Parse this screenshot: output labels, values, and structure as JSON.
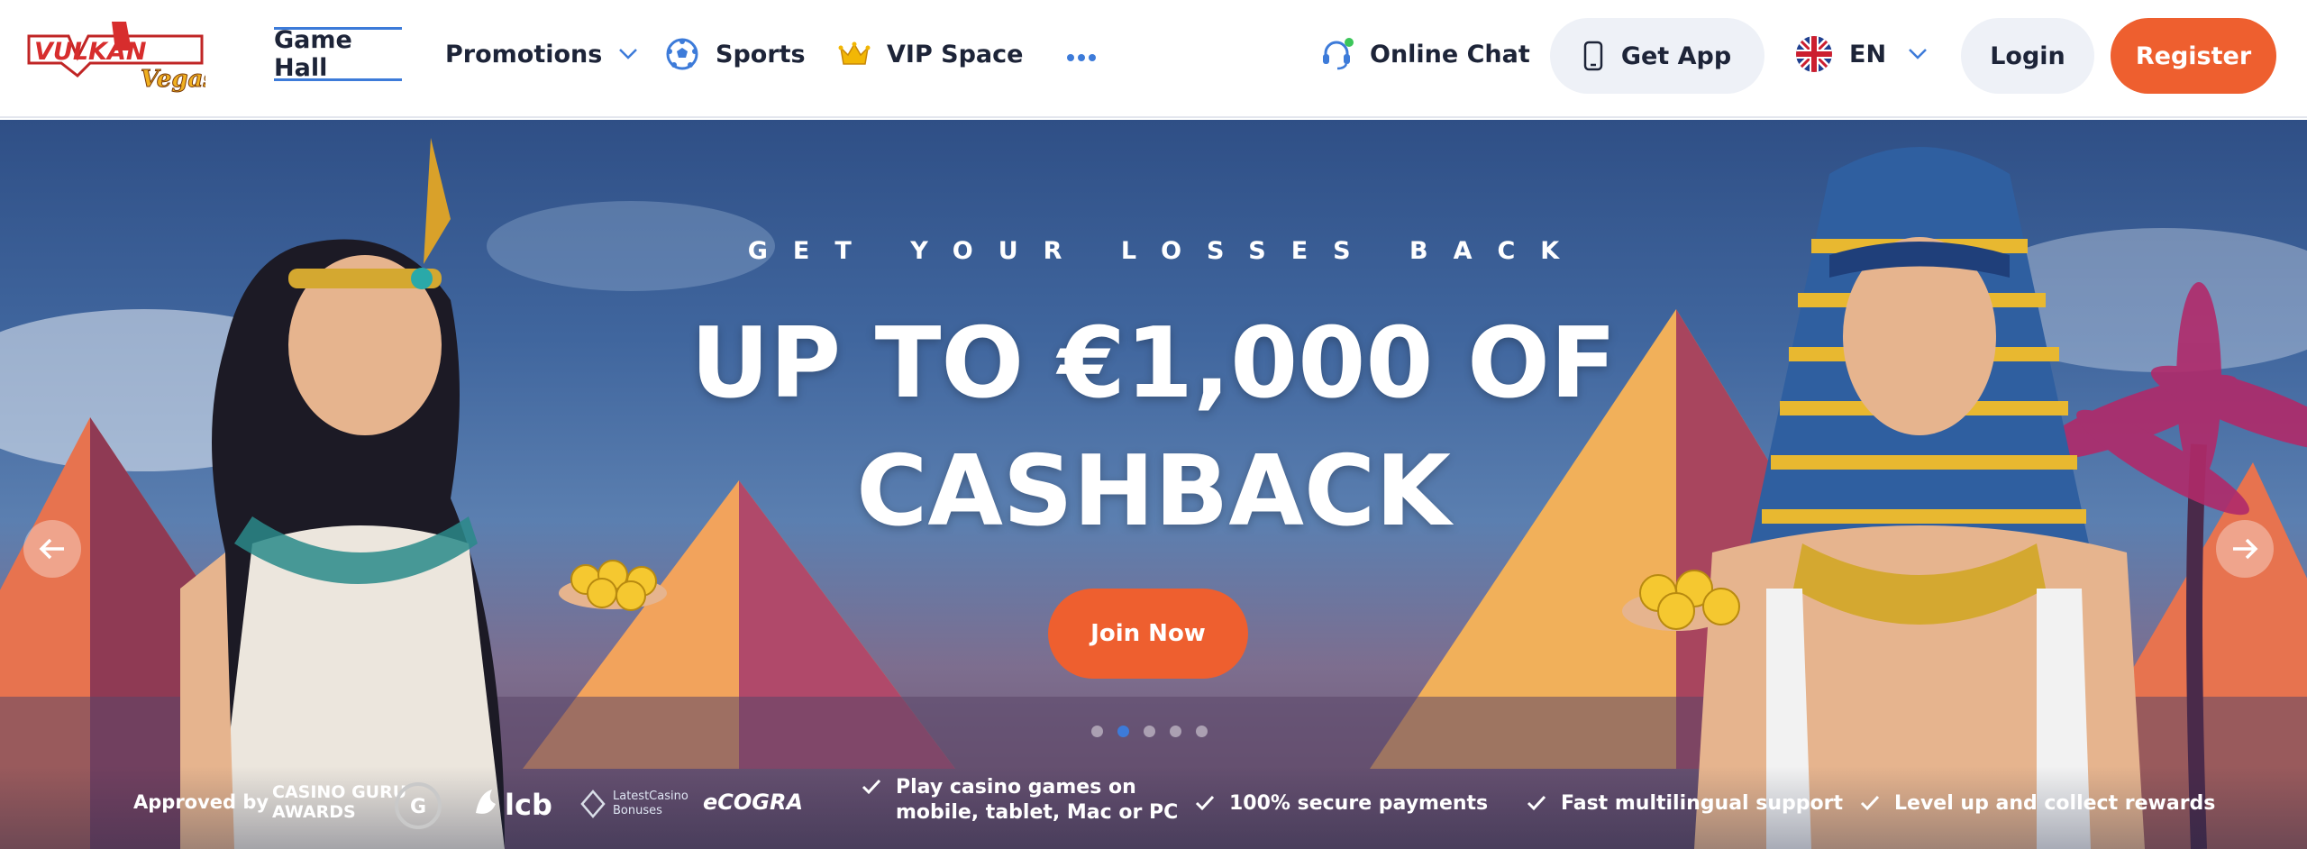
{
  "brand": {
    "logo_text_main": "VULKAN",
    "logo_text_sub": "Vegas",
    "colors": {
      "primary_red": "#d72d2d",
      "accent_orange": "#ee5f2f",
      "nav_text": "#1d2438",
      "active_blue": "#3d7bd9"
    }
  },
  "nav": {
    "items": [
      {
        "label": "Game Hall",
        "active": true
      },
      {
        "label": "Promotions",
        "icon": "chevron-down-icon"
      },
      {
        "label": "Sports",
        "icon": "soccer-ball-icon"
      },
      {
        "label": "VIP Space",
        "icon": "crown-icon"
      },
      {
        "label": "",
        "icon": "more-dots-icon"
      }
    ],
    "online_chat": "Online Chat",
    "get_app": "Get App",
    "language": "EN",
    "login": "Login",
    "register": "Register"
  },
  "hero": {
    "eyebrow": "GET YOUR LOSSES BACK",
    "headline_line1": "UP TO €1,000 OF",
    "headline_line2": "CASHBACK",
    "cta": "Join Now",
    "slides_count": 5,
    "active_slide": 2
  },
  "trust": {
    "approved_by": "Approved by",
    "badges": [
      {
        "line1": "CASINO GURU",
        "line2": "AWARDS"
      },
      {
        "line1": "lcb"
      },
      {
        "line1": "LatestCasino",
        "line2": "Bonuses"
      },
      {
        "line1": "eCOGRA"
      }
    ],
    "features": [
      {
        "line1": "Play casino games on",
        "line2": "mobile, tablet, Mac or PC"
      },
      {
        "line1": "100% secure payments"
      },
      {
        "line1": "Fast multilingual support"
      },
      {
        "line1": "Level up and collect rewards"
      }
    ]
  }
}
